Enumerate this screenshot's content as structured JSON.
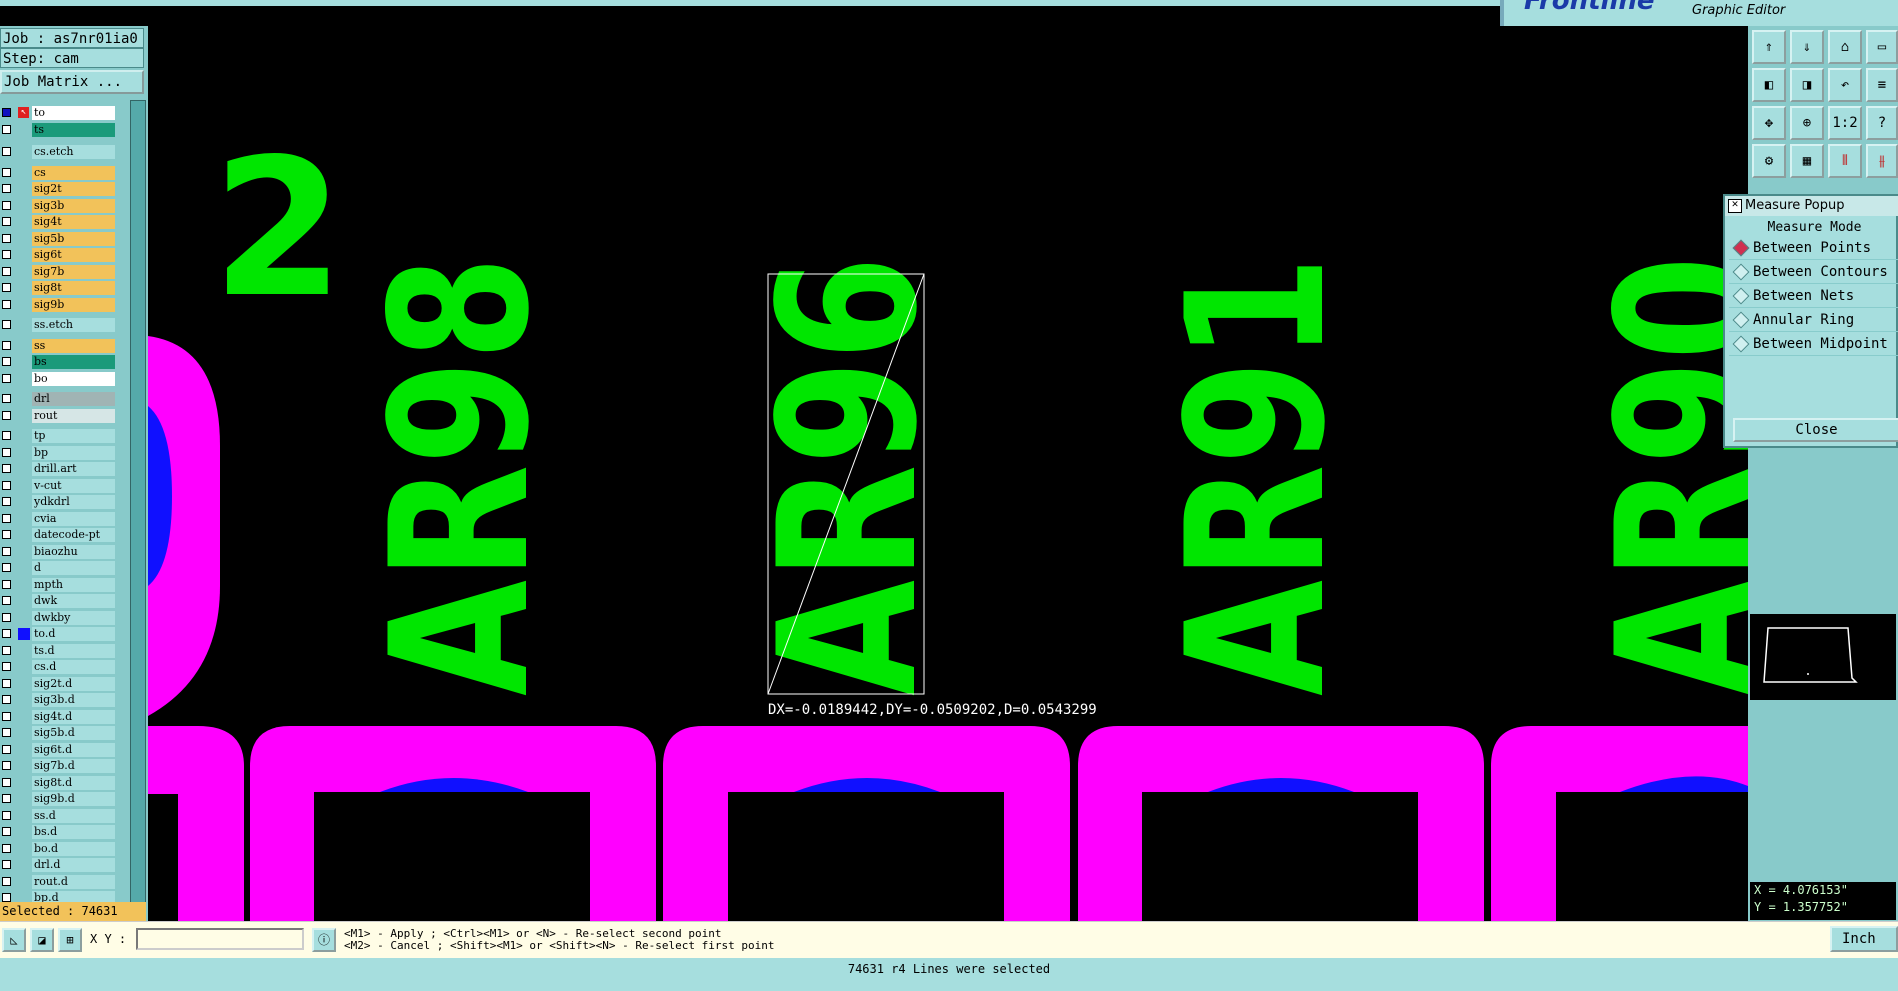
{
  "brand": {
    "name": "Frontline",
    "subtitle": "Graphic Editor"
  },
  "left": {
    "job_label": "Job : as7nr01ia0",
    "step_label": "Step: cam",
    "job_matrix_button": "Job Matrix ...",
    "selected_label": "Selected : 74631",
    "layers": [
      {
        "name": "to",
        "color": "#ffffff"
      },
      {
        "name": "ts",
        "color": "#1a9a7a"
      },
      {
        "name": "cs.etch",
        "color": "#a6dede"
      },
      {
        "name": "cs",
        "color": "#f2c25a"
      },
      {
        "name": "sig2t",
        "color": "#f2c25a"
      },
      {
        "name": "sig3b",
        "color": "#f2c25a"
      },
      {
        "name": "sig4t",
        "color": "#f2c25a"
      },
      {
        "name": "sig5b",
        "color": "#f2c25a"
      },
      {
        "name": "sig6t",
        "color": "#f2c25a"
      },
      {
        "name": "sig7b",
        "color": "#f2c25a"
      },
      {
        "name": "sig8t",
        "color": "#f2c25a"
      },
      {
        "name": "sig9b",
        "color": "#f2c25a"
      },
      {
        "name": "ss.etch",
        "color": "#a6dede"
      },
      {
        "name": "ss",
        "color": "#f2c25a"
      },
      {
        "name": "bs",
        "color": "#1a9a7a"
      },
      {
        "name": "bo",
        "color": "#ffffff"
      },
      {
        "name": "drl",
        "color": "#a0b4b4"
      },
      {
        "name": "rout",
        "color": "#d6e6e6"
      },
      {
        "name": "tp",
        "color": "#a6dede"
      },
      {
        "name": "bp",
        "color": "#a6dede"
      },
      {
        "name": "drill.art",
        "color": "#a6dede"
      },
      {
        "name": "v-cut",
        "color": "#a6dede"
      },
      {
        "name": "ydkdrl",
        "color": "#a6dede"
      },
      {
        "name": "cvia",
        "color": "#a6dede"
      },
      {
        "name": "datecode-pt",
        "color": "#a6dede"
      },
      {
        "name": "biaozhu",
        "color": "#a6dede"
      },
      {
        "name": "d",
        "color": "#a6dede"
      },
      {
        "name": "mpth",
        "color": "#a6dede"
      },
      {
        "name": "dwk",
        "color": "#a6dede"
      },
      {
        "name": "dwkby",
        "color": "#a6dede"
      },
      {
        "name": "to.d",
        "color": "#a6dede"
      },
      {
        "name": "ts.d",
        "color": "#a6dede"
      },
      {
        "name": "cs.d",
        "color": "#a6dede"
      },
      {
        "name": "sig2t.d",
        "color": "#a6dede"
      },
      {
        "name": "sig3b.d",
        "color": "#a6dede"
      },
      {
        "name": "sig4t.d",
        "color": "#a6dede"
      },
      {
        "name": "sig5b.d",
        "color": "#a6dede"
      },
      {
        "name": "sig6t.d",
        "color": "#a6dede"
      },
      {
        "name": "sig7b.d",
        "color": "#a6dede"
      },
      {
        "name": "sig8t.d",
        "color": "#a6dede"
      },
      {
        "name": "sig9b.d",
        "color": "#a6dede"
      },
      {
        "name": "ss.d",
        "color": "#a6dede"
      },
      {
        "name": "bs.d",
        "color": "#a6dede"
      },
      {
        "name": "bo.d",
        "color": "#a6dede"
      },
      {
        "name": "drl.d",
        "color": "#a6dede"
      },
      {
        "name": "rout.d",
        "color": "#a6dede"
      },
      {
        "name": "bp.d",
        "color": "#a6dede"
      }
    ]
  },
  "canvas": {
    "labels": [
      "2",
      "AR98",
      "AR96",
      "AR91",
      "AR90"
    ],
    "measure_result": "DX=-0.0189442,DY=-0.0509202,D=0.0543299",
    "colors": {
      "text": "#00e600",
      "pad": "#ff00ff",
      "drill": "#1010ff"
    }
  },
  "popup": {
    "title": "Measure Popup",
    "mode_label": "Measure Mode",
    "options": [
      "Between Points",
      "Between Contours",
      "Between Nets",
      "Annular Ring",
      "Between Midpoint"
    ],
    "selected": "Between Points",
    "close_button": "Close"
  },
  "right": {
    "zoom_label": "1:2",
    "help_label": "?",
    "coord_x": "X = 4.076153\"",
    "coord_y": "Y = 1.357752\""
  },
  "bottom": {
    "xy_label": "X Y :",
    "xy_value": "",
    "hint_line1": "<M1> - Apply  ; <Ctrl><M1> or <N> - Re-select second point",
    "hint_line2": "<M2> - Cancel ; <Shift><M1> or <Shift><N> - Re-select first point",
    "unit_button": "Inch",
    "status_text": "74631 r4 Lines were selected"
  }
}
